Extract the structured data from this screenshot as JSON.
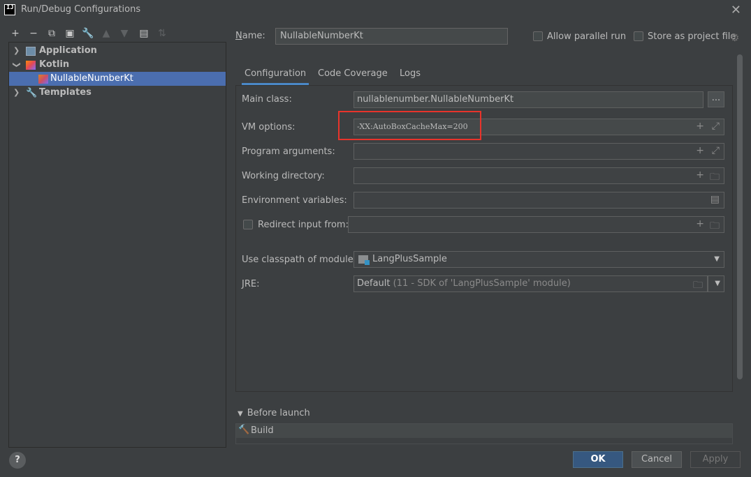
{
  "window": {
    "title": "Run/Debug Configurations",
    "app_icon_text": "IJ"
  },
  "tree": {
    "items": [
      {
        "label": "Application",
        "icon": "application-icon",
        "expanded": false
      },
      {
        "label": "Kotlin",
        "icon": "kotlin-icon",
        "expanded": true
      },
      {
        "label": "NullableNumberKt",
        "icon": "kotlin-file-icon",
        "selected": true
      },
      {
        "label": "Templates",
        "icon": "wrench-icon",
        "expanded": false
      }
    ]
  },
  "header": {
    "name_label": "Name:",
    "name_value": "NullableNumberKt",
    "allow_parallel_run": "Allow parallel run",
    "store_as_project_file": "Store as project file"
  },
  "tabs": [
    {
      "label": "Configuration",
      "active": true
    },
    {
      "label": "Code Coverage",
      "active": false
    },
    {
      "label": "Logs",
      "active": false
    }
  ],
  "form": {
    "main_class_label": "Main class:",
    "main_class_value": "nullablenumber.NullableNumberKt",
    "main_class_button": "...",
    "vm_options_label": "VM options:",
    "vm_options_value": "-XX:AutoBoxCacheMax=200",
    "program_arguments_label": "Program arguments:",
    "working_directory_label": "Working directory:",
    "environment_variables_label": "Environment variables:",
    "redirect_input_label": "Redirect input from:",
    "use_classpath_label": "Use classpath of module:",
    "use_classpath_value": "LangPlusSample",
    "jre_label": "JRE:",
    "jre_value_default": "Default",
    "jre_value_detail": "(11 - SDK of 'LangPlusSample' module)"
  },
  "before_launch": {
    "label": "Before launch",
    "tasks": [
      "Build"
    ]
  },
  "buttons": {
    "help": "?",
    "ok": "OK",
    "cancel": "Cancel",
    "apply": "Apply"
  },
  "colors": {
    "accent": "#4b6eaf",
    "highlight_box": "#e8342b",
    "ok_button": "#365880"
  }
}
